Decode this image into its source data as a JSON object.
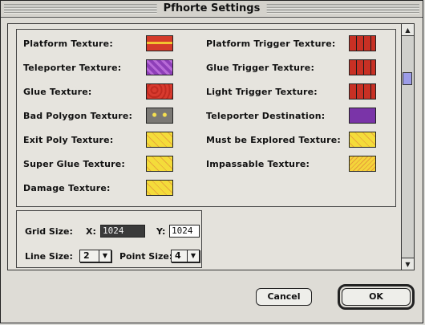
{
  "window": {
    "title": "Pfhorte Settings"
  },
  "textures_left": [
    {
      "label": "Platform Texture:",
      "swatch": "sw-platform"
    },
    {
      "label": "Teleporter Texture:",
      "swatch": "sw-teleporter"
    },
    {
      "label": "Glue Texture:",
      "swatch": "sw-glue"
    },
    {
      "label": "Bad Polygon Texture:",
      "swatch": "sw-bad"
    },
    {
      "label": "Exit Poly Texture:",
      "swatch": "sw-yellow"
    },
    {
      "label": "Super Glue Texture:",
      "swatch": "sw-yellow"
    },
    {
      "label": "Damage Texture:",
      "swatch": "sw-yellow"
    }
  ],
  "textures_right": [
    {
      "label": "Platform Trigger Texture:",
      "swatch": "sw-trigger"
    },
    {
      "label": "Glue Trigger Texture:",
      "swatch": "sw-trigger"
    },
    {
      "label": "Light Trigger Texture:",
      "swatch": "sw-trigger"
    },
    {
      "label": "Teleporter Destination:",
      "swatch": "sw-dest"
    },
    {
      "label": "Must be Explored Texture:",
      "swatch": "sw-yellow"
    },
    {
      "label": "Impassable Texture:",
      "swatch": "sw-impass"
    }
  ],
  "grid": {
    "grid_size_label": "Grid Size:",
    "x_label": "X:",
    "x_value": "1024",
    "y_label": "Y:",
    "y_value": "1024",
    "line_size_label": "Line Size:",
    "line_size_value": "2",
    "point_size_label": "Point Size:",
    "point_size_value": "4"
  },
  "buttons": {
    "cancel": "Cancel",
    "ok": "OK"
  },
  "colors": {
    "scroll_thumb": "#9c9ce8",
    "selection": "#3a3a3a"
  }
}
